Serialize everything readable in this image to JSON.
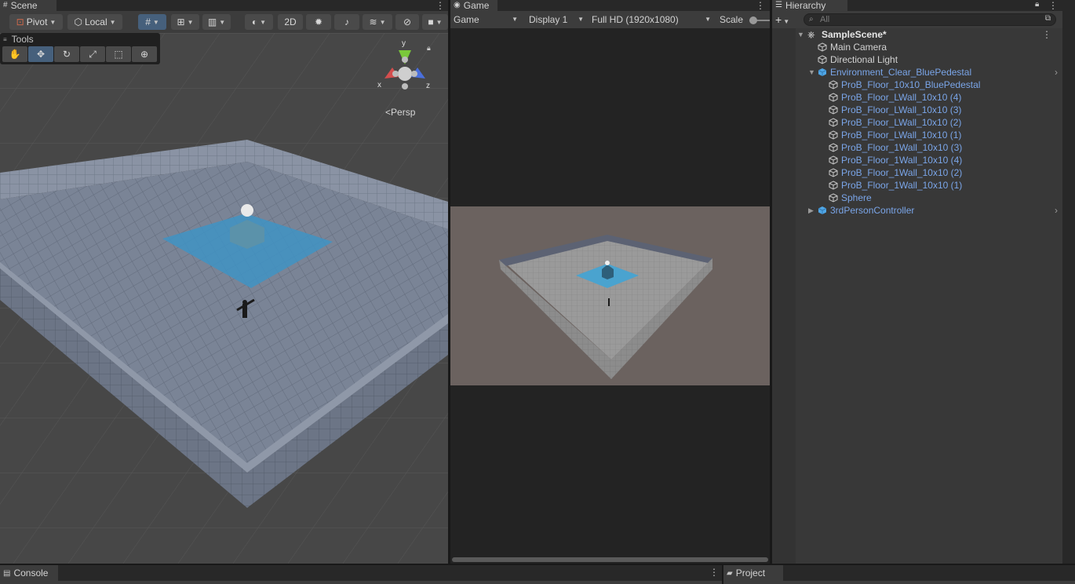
{
  "scene": {
    "tab_label": "Scene",
    "toolbar": {
      "pivot_label": "Pivot",
      "local_label": "Local",
      "mode_2d_label": "2D"
    },
    "tools_overlay_title": "Tools",
    "gizmo": {
      "x_label": "x",
      "y_label": "y",
      "z_label": "z",
      "projection_label": "Persp"
    }
  },
  "game": {
    "tab_label": "Game",
    "view_select": "Game",
    "display_select": "Display 1",
    "resolution_select": "Full HD (1920x1080)",
    "scale_label": "Scale"
  },
  "hierarchy": {
    "tab_label": "Hierarchy",
    "search_placeholder": "All",
    "scene_name": "SampleScene*",
    "items": [
      {
        "label": "Main Camera",
        "depth": 1
      },
      {
        "label": "Directional Light",
        "depth": 1
      },
      {
        "label": "Environment_Clear_BluePedestal",
        "depth": 1,
        "prefab": true,
        "expanded": true
      },
      {
        "label": "ProB_Floor_10x10_BluePedestal",
        "depth": 2,
        "prefab": true
      },
      {
        "label": "ProB_Floor_LWall_10x10 (4)",
        "depth": 2,
        "prefab": true
      },
      {
        "label": "ProB_Floor_LWall_10x10 (3)",
        "depth": 2,
        "prefab": true
      },
      {
        "label": "ProB_Floor_LWall_10x10 (2)",
        "depth": 2,
        "prefab": true
      },
      {
        "label": "ProB_Floor_LWall_10x10 (1)",
        "depth": 2,
        "prefab": true
      },
      {
        "label": "ProB_Floor_1Wall_10x10 (3)",
        "depth": 2,
        "prefab": true
      },
      {
        "label": "ProB_Floor_1Wall_10x10 (4)",
        "depth": 2,
        "prefab": true
      },
      {
        "label": "ProB_Floor_1Wall_10x10 (2)",
        "depth": 2,
        "prefab": true
      },
      {
        "label": "ProB_Floor_1Wall_10x10 (1)",
        "depth": 2,
        "prefab": true
      },
      {
        "label": "Sphere",
        "depth": 2,
        "prefab": true
      },
      {
        "label": "3rdPersonController",
        "depth": 1,
        "prefab": true,
        "expanded": false
      }
    ]
  },
  "bottom": {
    "console_tab_label": "Console",
    "project_tab_label": "Project"
  },
  "colors": {
    "prefab_text": "#7aa5e8",
    "active_tool": "#46607c",
    "panel_bg": "#383838",
    "game_bg": "#232323",
    "gizmo_x": "#d44e4e",
    "gizmo_y": "#7ac83a",
    "gizmo_z": "#4a6fdc"
  }
}
